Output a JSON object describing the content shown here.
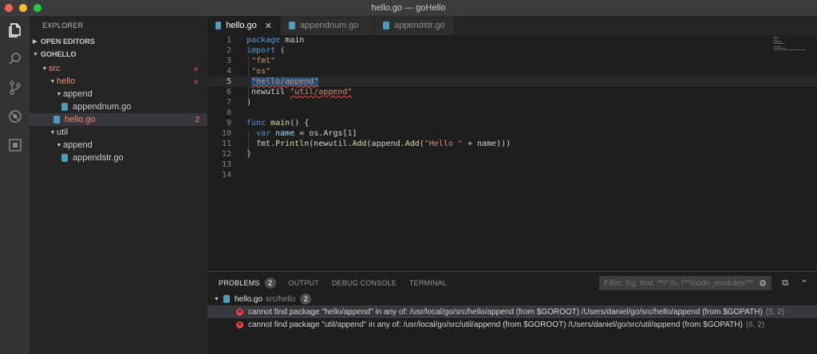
{
  "window": {
    "title": "hello.go — goHello"
  },
  "activity_bar": {
    "icons": [
      "files-icon",
      "search-icon",
      "source-control-icon",
      "debug-icon",
      "extensions-icon"
    ]
  },
  "sidebar": {
    "title": "EXPLORER",
    "sections": [
      {
        "label": "OPEN EDITORS"
      },
      {
        "label": "GOHELLO"
      }
    ],
    "tree": [
      {
        "label": "src",
        "count": ""
      },
      {
        "label": "hello",
        "count": ""
      },
      {
        "label": "append",
        "count": ""
      },
      {
        "label": "appendnum.go",
        "count": ""
      },
      {
        "label": "hello.go",
        "count": "2"
      },
      {
        "label": "util",
        "count": ""
      },
      {
        "label": "append",
        "count": ""
      },
      {
        "label": "appendstr.go",
        "count": ""
      }
    ]
  },
  "tabs": [
    {
      "label": "hello.go",
      "active": true
    },
    {
      "label": "appendnum.go",
      "active": false
    },
    {
      "label": "appendstr.go",
      "active": false
    }
  ],
  "editor": {
    "line_numbers": [
      "1",
      "2",
      "3",
      "4",
      "5",
      "6",
      "7",
      "8",
      "9",
      "10",
      "11",
      "12",
      "13",
      "14"
    ],
    "current_line": 5
  },
  "panel": {
    "tabs": [
      {
        "label": "PROBLEMS",
        "badge": "2"
      },
      {
        "label": "OUTPUT"
      },
      {
        "label": "DEBUG CONSOLE"
      },
      {
        "label": "TERMINAL"
      }
    ],
    "filter_placeholder": "Filter. Eg: text, **/*.ts, !**/node_modules/**",
    "file_group": {
      "file": "hello.go",
      "path": "src/hello",
      "count": "2"
    },
    "problems": [
      {
        "message": "cannot find package \"hello/append\" in any of: /usr/local/go/src/hello/append (from $GOROOT) /Users/daniel/go/src/hello/append (from $GOPATH)",
        "location": "(5, 2)"
      },
      {
        "message": "cannot find package \"util/append\" in any of: /usr/local/go/src/util/append (from $GOROOT) /Users/daniel/go/src/util/append (from $GOPATH)",
        "location": "(6, 2)"
      }
    ]
  },
  "colors": {
    "error": "#f48771",
    "keyword": "#569cd6",
    "string": "#ce9178",
    "function": "#dcdcaa",
    "selection": "#264f78"
  }
}
